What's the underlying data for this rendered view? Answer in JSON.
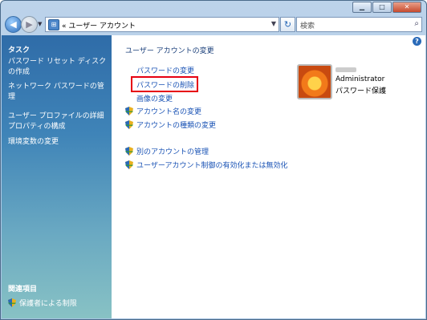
{
  "window": {
    "address": "« ユーザー アカウント",
    "search_placeholder": "検索"
  },
  "sidebar": {
    "heading": "タスク",
    "items": [
      {
        "label": "パスワード リセット ディスクの作成"
      },
      {
        "label": "ネットワーク パスワードの管理"
      },
      {
        "label": "ユーザー プロファイルの詳細プロパティの構成"
      },
      {
        "label": "環境変数の変更"
      }
    ],
    "related_heading": "関連項目",
    "related_item": "保護者による制限"
  },
  "main": {
    "heading": "ユーザー アカウントの変更",
    "links": [
      {
        "label": "パスワードの変更",
        "shield": false
      },
      {
        "label": "パスワードの削除",
        "shield": false,
        "highlighted": true
      },
      {
        "label": "画像の変更",
        "shield": false
      },
      {
        "label": "アカウント名の変更",
        "shield": true
      },
      {
        "label": "アカウントの種類の変更",
        "shield": true
      },
      {
        "label": "別のアカウントの管理",
        "shield": true
      },
      {
        "label": "ユーザーアカウント制御の有効化または無効化",
        "shield": true
      }
    ]
  },
  "user": {
    "name": "Administrator",
    "status": "パスワード保護"
  },
  "colors": {
    "highlight": "#e60012",
    "link": "#1a53b5",
    "sidebar_top": "#2f6ca8"
  }
}
